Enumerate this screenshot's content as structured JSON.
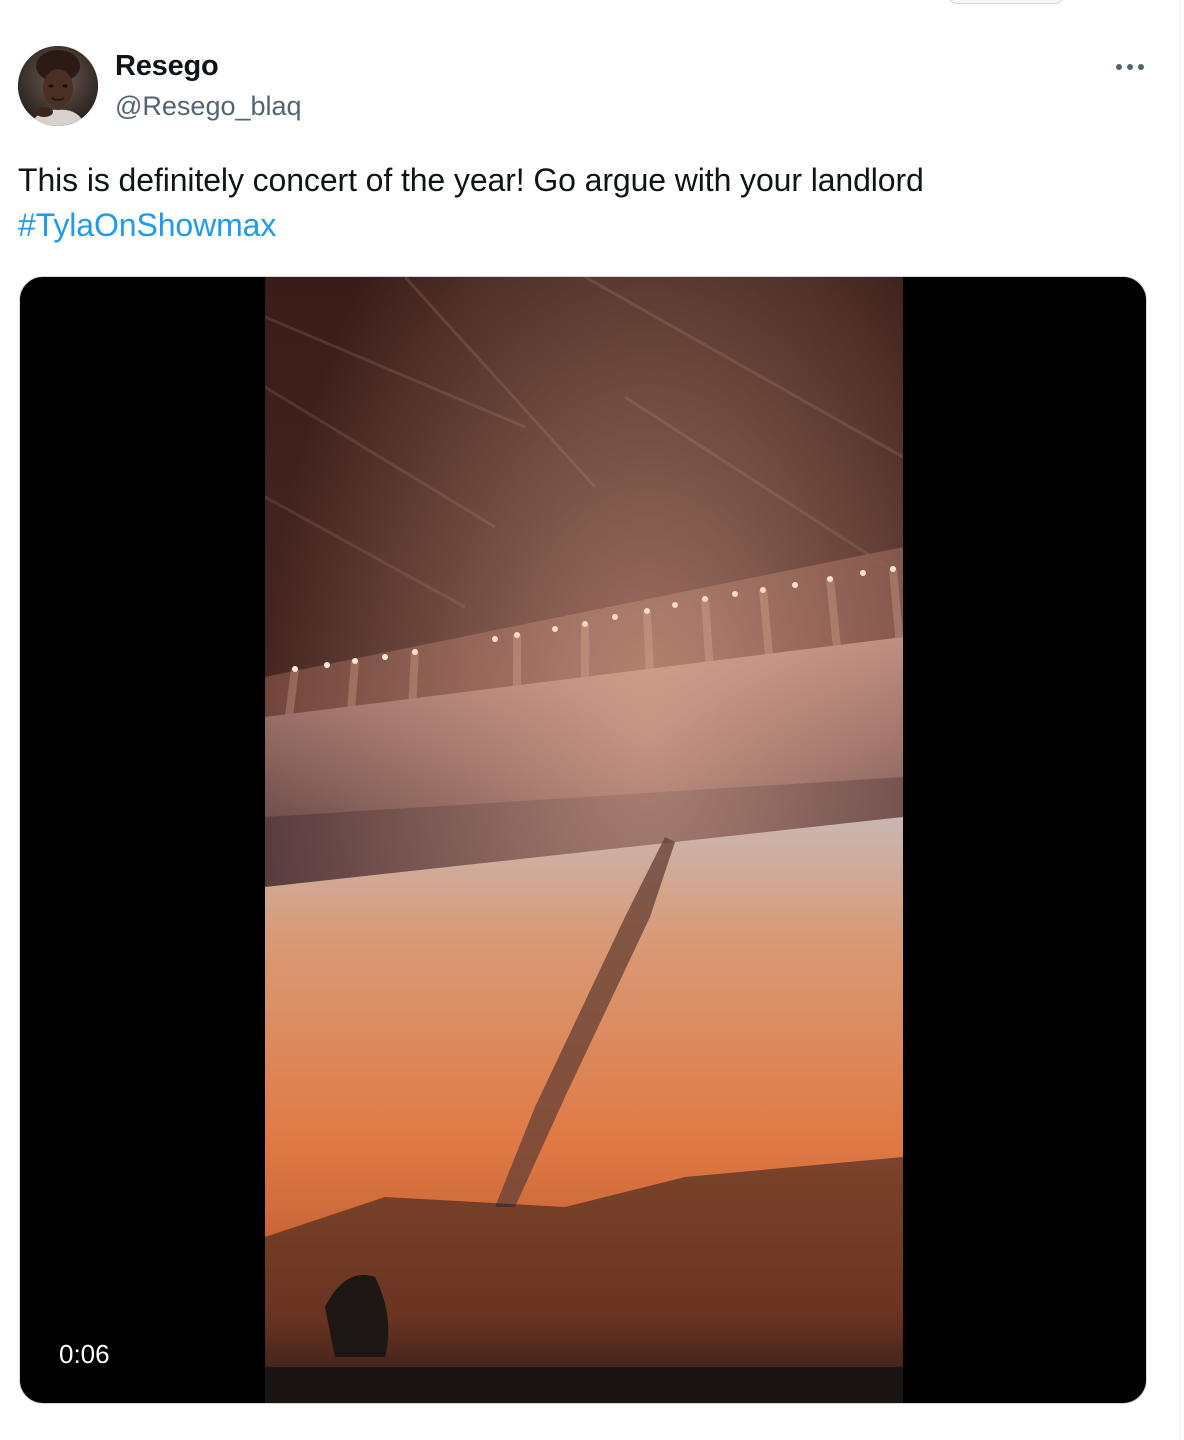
{
  "tweet": {
    "author": {
      "display_name": "Resego",
      "handle": "@Resego_blaq",
      "avatar_icon": "profile-photo"
    },
    "more_icon": "more-horizontal-icon",
    "text_line_1": "This is definitely concert of the year! Go argue with your landlord",
    "hashtag": "#TylaOnShowmax",
    "media": {
      "type": "video",
      "duration": "0:06",
      "description_icon": "concert-arena-crowd-video"
    }
  },
  "colors": {
    "text": "#0f1419",
    "secondary_text": "#536471",
    "link": "#1d9bf0",
    "border": "#cfd9de"
  }
}
